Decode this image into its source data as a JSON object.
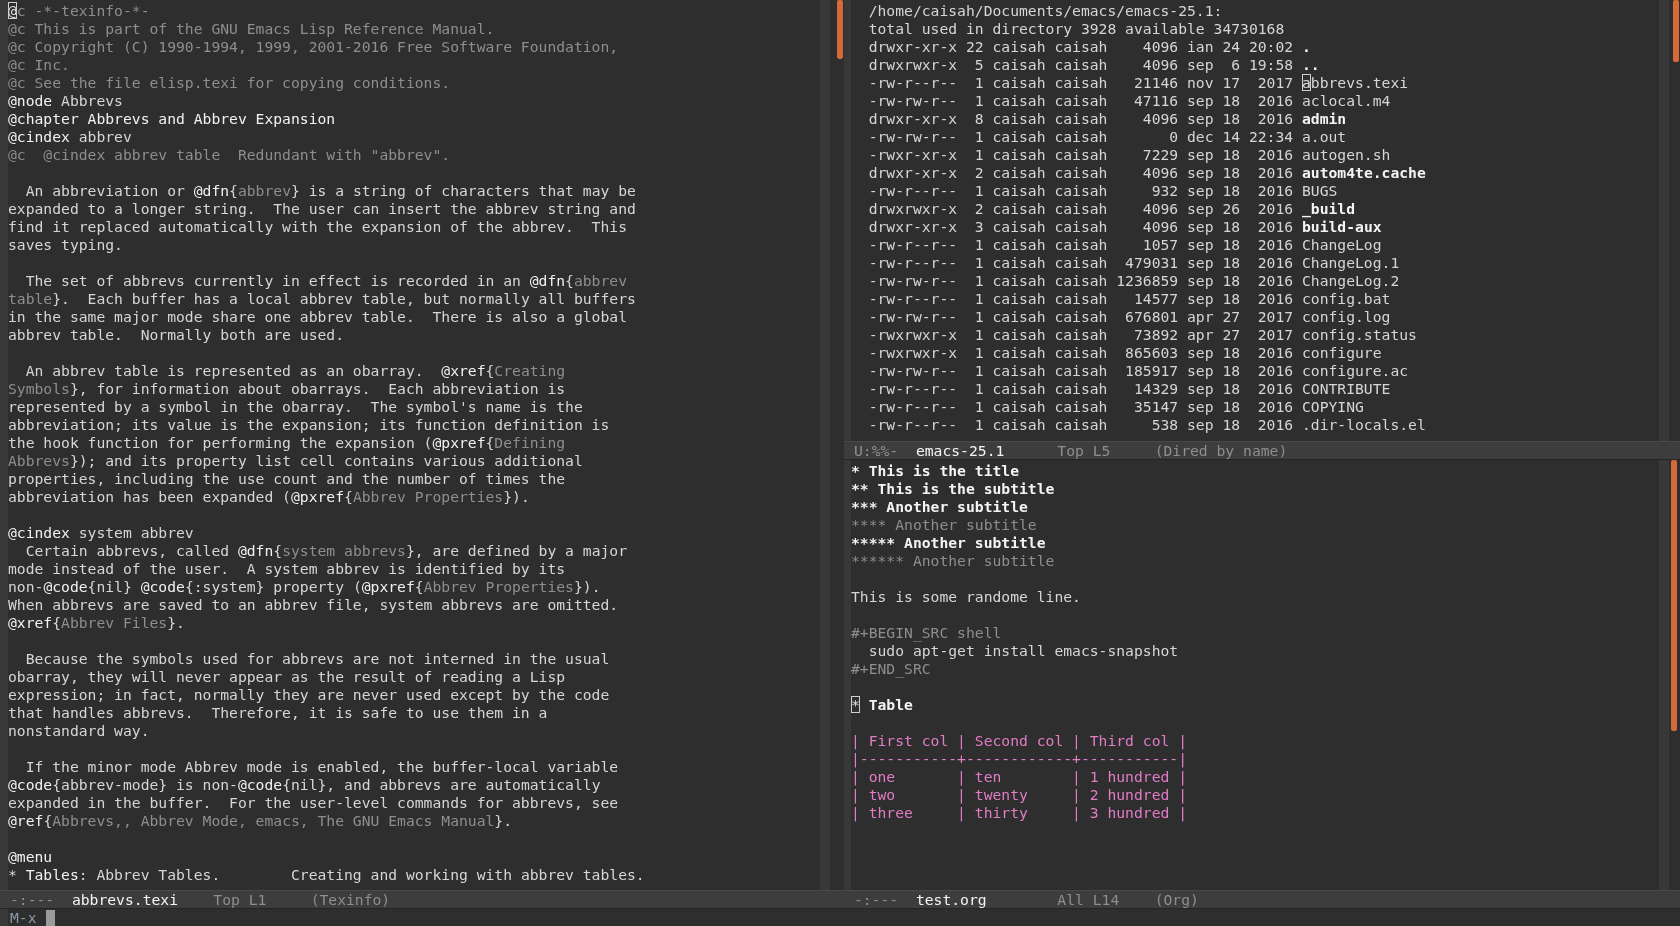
{
  "left_window": {
    "blocks": [
      [
        [
          {
            "kind": "cursor",
            "text": "@"
          },
          {
            "kind": "comment",
            "text": "c -*-texinfo-*-"
          }
        ],
        [
          {
            "kind": "comment",
            "text": "@c This is part of the GNU Emacs Lisp Reference Manual."
          }
        ],
        [
          {
            "kind": "comment",
            "text": "@c Copyright (C) 1990-1994, 1999, 2001-2016 Free Software Foundation,"
          }
        ],
        [
          {
            "kind": "comment",
            "text": "@c Inc."
          }
        ],
        [
          {
            "kind": "comment",
            "text": "@c See the file elisp.texi for copying conditions."
          }
        ],
        [
          {
            "kind": "keyword",
            "text": "@node"
          },
          {
            "kind": "default",
            "text": " Abbrevs"
          }
        ],
        [
          {
            "kind": "keyword",
            "text": "@chapter Abbrevs and Abbrev Expansion"
          }
        ],
        [
          {
            "kind": "keyword",
            "text": "@cindex"
          },
          {
            "kind": "default",
            "text": " abbrev"
          }
        ],
        [
          {
            "kind": "comment",
            "text": "@c  @cindex abbrev table  Redundant with \"abbrev\"."
          }
        ]
      ],
      [
        [
          {
            "kind": "default",
            "text": "  An abbreviation or "
          },
          {
            "kind": "keyword",
            "text": "@dfn"
          },
          {
            "kind": "default",
            "text": "{"
          },
          {
            "kind": "arg",
            "text": "abbrev"
          },
          {
            "kind": "default",
            "text": "} is a string of characters that may be"
          }
        ],
        [
          {
            "kind": "default",
            "text": "expanded to a longer string.  The user can insert the abbrev string and"
          }
        ],
        [
          {
            "kind": "default",
            "text": "find it replaced automatically with the expansion of the abbrev.  This"
          }
        ],
        [
          {
            "kind": "default",
            "text": "saves typing."
          }
        ]
      ],
      [
        [
          {
            "kind": "default",
            "text": "  The set of abbrevs currently in effect is recorded in an "
          },
          {
            "kind": "keyword",
            "text": "@dfn"
          },
          {
            "kind": "default",
            "text": "{"
          },
          {
            "kind": "arg",
            "text": "abbrev"
          }
        ],
        [
          {
            "kind": "arg",
            "text": "table"
          },
          {
            "kind": "default",
            "text": "}.  Each buffer has a local abbrev table, but normally all buffers"
          }
        ],
        [
          {
            "kind": "default",
            "text": "in the same major mode share one abbrev table.  There is also a global"
          }
        ],
        [
          {
            "kind": "default",
            "text": "abbrev table.  Normally both are used."
          }
        ]
      ],
      [
        [
          {
            "kind": "default",
            "text": "  An abbrev table is represented as an obarray.  "
          },
          {
            "kind": "keyword",
            "text": "@xref"
          },
          {
            "kind": "default",
            "text": "{"
          },
          {
            "kind": "arg",
            "text": "Creating"
          }
        ],
        [
          {
            "kind": "arg",
            "text": "Symbols"
          },
          {
            "kind": "default",
            "text": "}, for information about obarrays.  Each abbreviation is"
          }
        ],
        [
          {
            "kind": "default",
            "text": "represented by a symbol in the obarray.  The symbol's name is the"
          }
        ],
        [
          {
            "kind": "default",
            "text": "abbreviation; its value is the expansion; its function definition is"
          }
        ],
        [
          {
            "kind": "default",
            "text": "the hook function for performing the expansion ("
          },
          {
            "kind": "keyword",
            "text": "@pxref"
          },
          {
            "kind": "default",
            "text": "{"
          },
          {
            "kind": "arg",
            "text": "Defining"
          }
        ],
        [
          {
            "kind": "arg",
            "text": "Abbrevs"
          },
          {
            "kind": "default",
            "text": "}); and its property list cell contains various additional"
          }
        ],
        [
          {
            "kind": "default",
            "text": "properties, including the use count and the number of times the"
          }
        ],
        [
          {
            "kind": "default",
            "text": "abbreviation has been expanded ("
          },
          {
            "kind": "keyword",
            "text": "@pxref"
          },
          {
            "kind": "default",
            "text": "{"
          },
          {
            "kind": "arg",
            "text": "Abbrev Properties"
          },
          {
            "kind": "default",
            "text": "})."
          }
        ]
      ],
      [
        [
          {
            "kind": "keyword",
            "text": "@cindex"
          },
          {
            "kind": "default",
            "text": " system abbrev"
          }
        ],
        [
          {
            "kind": "default",
            "text": "  Certain abbrevs, called "
          },
          {
            "kind": "keyword",
            "text": "@dfn"
          },
          {
            "kind": "default",
            "text": "{"
          },
          {
            "kind": "arg",
            "text": "system abbrevs"
          },
          {
            "kind": "default",
            "text": "}, are defined by a major"
          }
        ],
        [
          {
            "kind": "default",
            "text": "mode instead of the user.  A system abbrev is identified by its"
          }
        ],
        [
          {
            "kind": "default",
            "text": "non-"
          },
          {
            "kind": "keyword",
            "text": "@code"
          },
          {
            "kind": "default",
            "text": "{nil} "
          },
          {
            "kind": "keyword",
            "text": "@code"
          },
          {
            "kind": "default",
            "text": "{:system} property ("
          },
          {
            "kind": "keyword",
            "text": "@pxref"
          },
          {
            "kind": "default",
            "text": "{"
          },
          {
            "kind": "arg",
            "text": "Abbrev Properties"
          },
          {
            "kind": "default",
            "text": "})."
          }
        ],
        [
          {
            "kind": "default",
            "text": "When abbrevs are saved to an abbrev file, system abbrevs are omitted."
          }
        ],
        [
          {
            "kind": "keyword",
            "text": "@xref"
          },
          {
            "kind": "default",
            "text": "{"
          },
          {
            "kind": "arg",
            "text": "Abbrev Files"
          },
          {
            "kind": "default",
            "text": "}."
          }
        ]
      ],
      [
        [
          {
            "kind": "default",
            "text": "  Because the symbols used for abbrevs are not interned in the usual"
          }
        ],
        [
          {
            "kind": "default",
            "text": "obarray, they will never appear as the result of reading a Lisp"
          }
        ],
        [
          {
            "kind": "default",
            "text": "expression; in fact, normally they are never used except by the code"
          }
        ],
        [
          {
            "kind": "default",
            "text": "that handles abbrevs.  Therefore, it is safe to use them in a"
          }
        ],
        [
          {
            "kind": "default",
            "text": "nonstandard way."
          }
        ]
      ],
      [
        [
          {
            "kind": "default",
            "text": "  If the minor mode Abbrev mode is enabled, the buffer-local variable"
          }
        ],
        [
          {
            "kind": "keyword",
            "text": "@code"
          },
          {
            "kind": "default",
            "text": "{abbrev-mode} is non-"
          },
          {
            "kind": "keyword",
            "text": "@code"
          },
          {
            "kind": "default",
            "text": "{nil}, and abbrevs are automatically"
          }
        ],
        [
          {
            "kind": "default",
            "text": "expanded in the buffer.  For the user-level commands for abbrevs, see"
          }
        ],
        [
          {
            "kind": "keyword",
            "text": "@ref"
          },
          {
            "kind": "default",
            "text": "{"
          },
          {
            "kind": "arg",
            "text": "Abbrevs,, Abbrev Mode, emacs, The GNU Emacs Manual"
          },
          {
            "kind": "default",
            "text": "}."
          }
        ]
      ],
      [
        [
          {
            "kind": "keyword",
            "text": "@menu"
          }
        ],
        [
          {
            "kind": "default",
            "text": "* "
          },
          {
            "kind": "keyword",
            "text": "Tables"
          },
          {
            "kind": "default",
            "text": ": Abbrev Tables.        Creating and working with abbrev tables."
          }
        ]
      ]
    ],
    "mode_line": {
      "status": "-:---",
      "buffer": "abbrevs.texi",
      "position": "Top L1",
      "mode": "(Texinfo)"
    }
  },
  "top_right_window": {
    "blocks": [
      [
        [
          {
            "kind": "default",
            "text": "  /home/caisah/Documents/emacs/emacs-25.1:"
          }
        ],
        [
          {
            "kind": "default",
            "text": "  total used in directory 3928 available 34730168"
          }
        ],
        [
          {
            "kind": "default",
            "text": "  drwxr-xr-x 22 caisah caisah    4096 ian 24 20:02 "
          },
          {
            "kind": "directory",
            "text": "."
          }
        ],
        [
          {
            "kind": "default",
            "text": "  drwxrwxr-x  5 caisah caisah    4096 sep  6 19:58 "
          },
          {
            "kind": "directory",
            "text": ".."
          }
        ],
        [
          {
            "kind": "default",
            "text": "  -rw-r--r--  1 caisah caisah   21146 nov 17  2017 "
          },
          {
            "kind": "cursor",
            "text": "a"
          },
          {
            "kind": "default",
            "text": "bbrevs.texi"
          }
        ],
        [
          {
            "kind": "default",
            "text": "  -rw-rw-r--  1 caisah caisah   47116 sep 18  2016 aclocal.m4"
          }
        ],
        [
          {
            "kind": "default",
            "text": "  drwxr-xr-x  8 caisah caisah    4096 sep 18  2016 "
          },
          {
            "kind": "directory",
            "text": "admin"
          }
        ],
        [
          {
            "kind": "default",
            "text": "  -rw-rw-r--  1 caisah caisah       0 dec 14 22:34 a.out"
          }
        ],
        [
          {
            "kind": "default",
            "text": "  -rwxr-xr-x  1 caisah caisah    7229 sep 18  2016 autogen.sh"
          }
        ],
        [
          {
            "kind": "default",
            "text": "  drwxr-xr-x  2 caisah caisah    4096 sep 18  2016 "
          },
          {
            "kind": "directory",
            "text": "autom4te.cache"
          }
        ],
        [
          {
            "kind": "default",
            "text": "  -rw-r--r--  1 caisah caisah     932 sep 18  2016 BUGS"
          }
        ],
        [
          {
            "kind": "default",
            "text": "  drwxrwxr-x  2 caisah caisah    4096 sep 26  2016 "
          },
          {
            "kind": "directory",
            "text": "_build"
          }
        ],
        [
          {
            "kind": "default",
            "text": "  drwxr-xr-x  3 caisah caisah    4096 sep 18  2016 "
          },
          {
            "kind": "directory",
            "text": "build-aux"
          }
        ],
        [
          {
            "kind": "default",
            "text": "  -rw-r--r--  1 caisah caisah    1057 sep 18  2016 ChangeLog"
          }
        ],
        [
          {
            "kind": "default",
            "text": "  -rw-r--r--  1 caisah caisah  479031 sep 18  2016 ChangeLog.1"
          }
        ],
        [
          {
            "kind": "default",
            "text": "  -rw-rw-r--  1 caisah caisah 1236859 sep 18  2016 ChangeLog.2"
          }
        ],
        [
          {
            "kind": "default",
            "text": "  -rw-r--r--  1 caisah caisah   14577 sep 18  2016 config.bat"
          }
        ],
        [
          {
            "kind": "default",
            "text": "  -rw-rw-r--  1 caisah caisah  676801 apr 27  2017 config.log"
          }
        ],
        [
          {
            "kind": "default",
            "text": "  -rwxrwxr-x  1 caisah caisah   73892 apr 27  2017 config.status"
          }
        ],
        [
          {
            "kind": "default",
            "text": "  -rwxrwxr-x  1 caisah caisah  865603 sep 18  2016 configure"
          }
        ],
        [
          {
            "kind": "default",
            "text": "  -rw-rw-r--  1 caisah caisah  185917 sep 18  2016 configure.ac"
          }
        ],
        [
          {
            "kind": "default",
            "text": "  -rw-r--r--  1 caisah caisah   14329 sep 18  2016 CONTRIBUTE"
          }
        ],
        [
          {
            "kind": "default",
            "text": "  -rw-r--r--  1 caisah caisah   35147 sep 18  2016 COPYING"
          }
        ],
        [
          {
            "kind": "default",
            "text": "  -rw-r--r--  1 caisah caisah     538 sep 18  2016 .dir-locals.el"
          }
        ]
      ]
    ],
    "mode_line": {
      "status": "U:%%-",
      "buffer": "emacs-25.1",
      "position": "Top L5",
      "mode": "(Dired by name)"
    }
  },
  "bottom_right_window": {
    "blocks": [
      [
        [
          {
            "kind": "heading",
            "text": "* This is the title"
          }
        ],
        [
          {
            "kind": "heading",
            "text": "** This is the subtitle"
          }
        ],
        [
          {
            "kind": "heading",
            "text": "*** Another subtitle"
          }
        ],
        [
          {
            "kind": "heading-dim",
            "text": "**** Another subtitle"
          }
        ],
        [
          {
            "kind": "heading",
            "text": "***** Another subtitle"
          }
        ],
        [
          {
            "kind": "heading-dim",
            "text": "****** Another subtitle"
          }
        ]
      ],
      [
        [
          {
            "kind": "default",
            "text": "This is some randome line."
          }
        ]
      ],
      [
        [
          {
            "kind": "meta",
            "text": "#+BEGIN_SRC shell"
          }
        ],
        [
          {
            "kind": "default",
            "text": "  sudo apt-get install emacs-snapshot"
          }
        ],
        [
          {
            "kind": "meta",
            "text": "#+END_SRC"
          }
        ]
      ],
      [
        [
          {
            "kind": "cursor",
            "text": "*"
          },
          {
            "kind": "heading",
            "text": " Table"
          }
        ]
      ],
      [
        [
          {
            "kind": "table",
            "text": "| First col | Second col | Third col |"
          }
        ],
        [
          {
            "kind": "table",
            "text": "|-----------+------------+-----------|"
          }
        ],
        [
          {
            "kind": "table",
            "text": "| one       | ten        | 1 hundred |"
          }
        ],
        [
          {
            "kind": "table",
            "text": "| two       | twenty     | 2 hundred |"
          }
        ],
        [
          {
            "kind": "table",
            "text": "| three     | thirty     | 3 hundred |"
          }
        ]
      ]
    ],
    "mode_line": {
      "status": "-:---",
      "buffer": "test.org",
      "position": "All L14",
      "mode": "(Org)"
    }
  },
  "minibuffer": {
    "prompt": "M-x"
  }
}
